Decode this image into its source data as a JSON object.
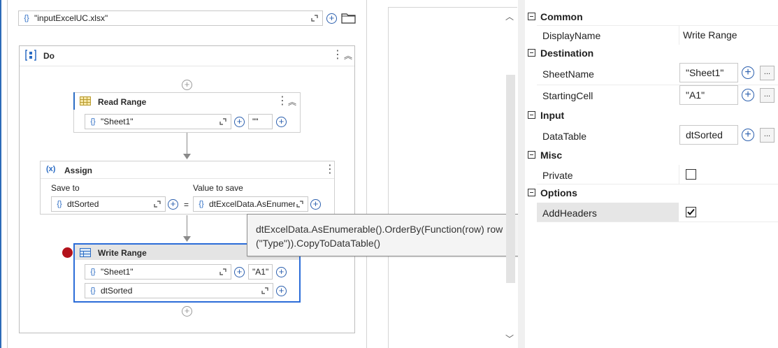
{
  "designer": {
    "workbook_path": "\"inputExcelUC.xlsx\"",
    "do_label": "Do",
    "read_range": {
      "title": "Read Range",
      "sheet": "\"Sheet1\"",
      "range": "\"\""
    },
    "assign": {
      "title": "Assign",
      "save_to_label": "Save to",
      "value_label": "Value to save",
      "save_to_value": "dtSorted",
      "equals": "=",
      "value_to_save": "dtExcelData.AsEnumer"
    },
    "write_range": {
      "title": "Write Range",
      "sheet": "\"Sheet1\"",
      "cell": "\"A1\"",
      "datatable": "dtSorted"
    },
    "tooltip": "dtExcelData.AsEnumerable().OrderBy(Function(row) row (\"Type\")).CopyToDataTable()"
  },
  "properties": {
    "common": {
      "header": "Common",
      "display_name_label": "DisplayName",
      "display_name_value": "Write Range"
    },
    "destination": {
      "header": "Destination",
      "sheet_label": "SheetName",
      "sheet_value": "\"Sheet1\"",
      "cell_label": "StartingCell",
      "cell_value": "\"A1\""
    },
    "input": {
      "header": "Input",
      "datatable_label": "DataTable",
      "datatable_value": "dtSorted"
    },
    "misc": {
      "header": "Misc",
      "private_label": "Private",
      "private_checked": false
    },
    "options": {
      "header": "Options",
      "add_headers_label": "AddHeaders",
      "add_headers_checked": true
    },
    "more_button": "..."
  },
  "colors": {
    "accent": "#2b6cc4",
    "breakpoint": "#b3121b",
    "selected_border": "#2b6cd8"
  }
}
